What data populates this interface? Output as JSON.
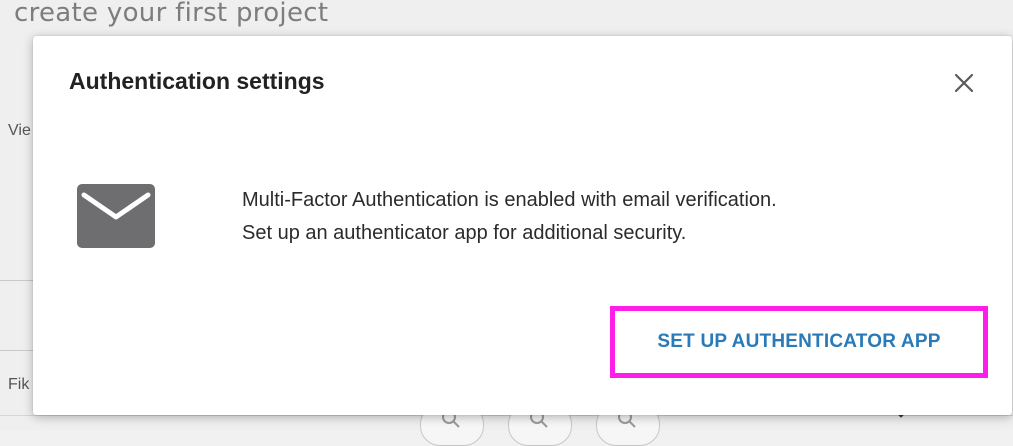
{
  "background": {
    "title": "create your first project",
    "left_fragment_top": "Vie",
    "left_fragment_bottom": "Fik"
  },
  "modal": {
    "title": "Authentication settings",
    "close_icon": "close-icon",
    "mail_icon": "envelope-icon",
    "message_line1": "Multi-Factor Authentication is enabled with email verification.",
    "message_line2": "Set up an authenticator app for additional security.",
    "action_label": "SET UP AUTHENTICATOR APP"
  },
  "colors": {
    "accent_text": "#2a7ab7",
    "highlight_border": "#ff1dea",
    "icon_gray": "#6e6e70"
  }
}
